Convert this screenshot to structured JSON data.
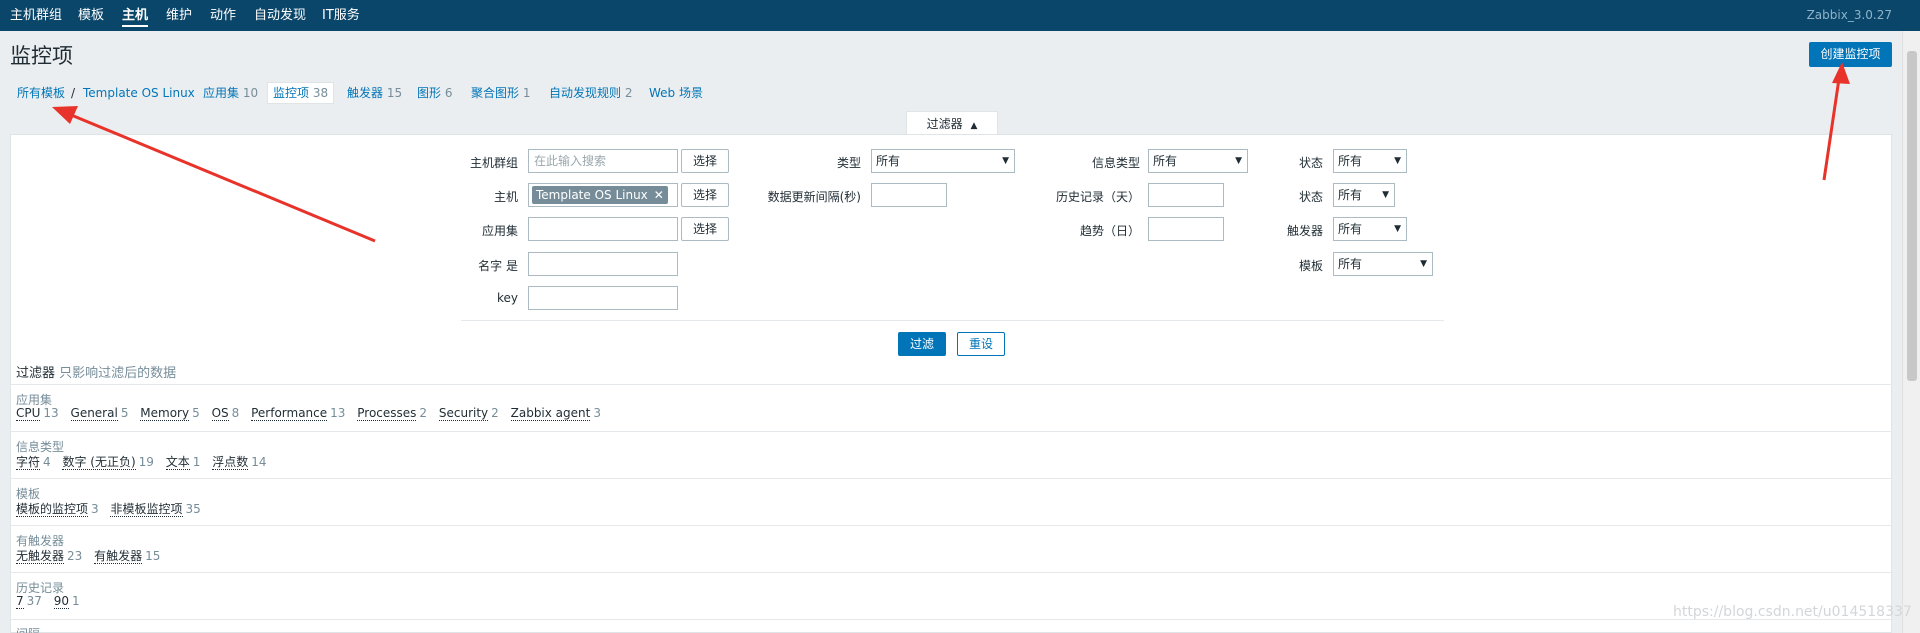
{
  "topnav": {
    "items": [
      "主机群组",
      "模板",
      "主机",
      "维护",
      "动作",
      "自动发现",
      "IT服务"
    ],
    "active_index": 2,
    "version": "Zabbix_3.0.27"
  },
  "header": {
    "title": "监控项",
    "create_button": "创建监控项"
  },
  "breadcrumb": {
    "all_templates": "所有模板",
    "separator": "/",
    "template": "Template OS Linux",
    "tabs": [
      {
        "label": "应用集",
        "count": "10"
      },
      {
        "label": "监控项",
        "count": "38"
      },
      {
        "label": "触发器",
        "count": "15"
      },
      {
        "label": "图形",
        "count": "6"
      },
      {
        "label": "聚合图形",
        "count": "1"
      },
      {
        "label": "自动发现规则",
        "count": "2"
      },
      {
        "label": "Web 场景",
        "count": ""
      }
    ]
  },
  "filter": {
    "tab_label": "过滤器",
    "tab_arrow": "▲",
    "labels": {
      "host_group": "主机群组",
      "host": "主机",
      "application": "应用集",
      "name": "名字 是",
      "key": "key",
      "type": "类型",
      "update_interval": "数据更新间隔(秒)",
      "info_type": "信息类型",
      "history": "历史记录（天）",
      "trends": "趋势（日）",
      "state": "状态",
      "status": "状态",
      "triggers": "触发器",
      "template": "模板"
    },
    "host_group_placeholder": "在此输入搜索",
    "host_tag": "Template OS Linux",
    "tag_remove": "✕",
    "select_label": "选择",
    "dropdown_value": "所有",
    "dropdown_arrow": "▼",
    "apply_button": "过滤",
    "reset_button": "重设"
  },
  "subfilter": {
    "title": "过滤器",
    "hint": "只影响过滤后的数据",
    "sections": [
      {
        "title": "应用集",
        "items": [
          {
            "label": "CPU",
            "count": "13"
          },
          {
            "label": "General",
            "count": "5"
          },
          {
            "label": "Memory",
            "count": "5"
          },
          {
            "label": "OS",
            "count": "8"
          },
          {
            "label": "Performance",
            "count": "13"
          },
          {
            "label": "Processes",
            "count": "2"
          },
          {
            "label": "Security",
            "count": "2"
          },
          {
            "label": "Zabbix agent",
            "count": "3"
          }
        ]
      },
      {
        "title": "信息类型",
        "items": [
          {
            "label": "字符",
            "count": "4"
          },
          {
            "label": "数字 (无正负)",
            "count": "19"
          },
          {
            "label": "文本",
            "count": "1"
          },
          {
            "label": "浮点数",
            "count": "14"
          }
        ]
      },
      {
        "title": "模板",
        "items": [
          {
            "label": "模板的监控项",
            "count": "3"
          },
          {
            "label": "非模板监控项",
            "count": "35"
          }
        ]
      },
      {
        "title": "有触发器",
        "items": [
          {
            "label": "无触发器",
            "count": "23"
          },
          {
            "label": "有触发器",
            "count": "15"
          }
        ]
      },
      {
        "title": "历史记录",
        "items": [
          {
            "label": "7",
            "count": "37"
          },
          {
            "label": "90",
            "count": "1"
          }
        ]
      },
      {
        "title": "间隔",
        "items": []
      }
    ]
  },
  "watermark": "https://blog.csdn.net/u014518337",
  "colors": {
    "nav": "#0a466a",
    "accent": "#0275b8",
    "annotation": "#e8332a"
  }
}
